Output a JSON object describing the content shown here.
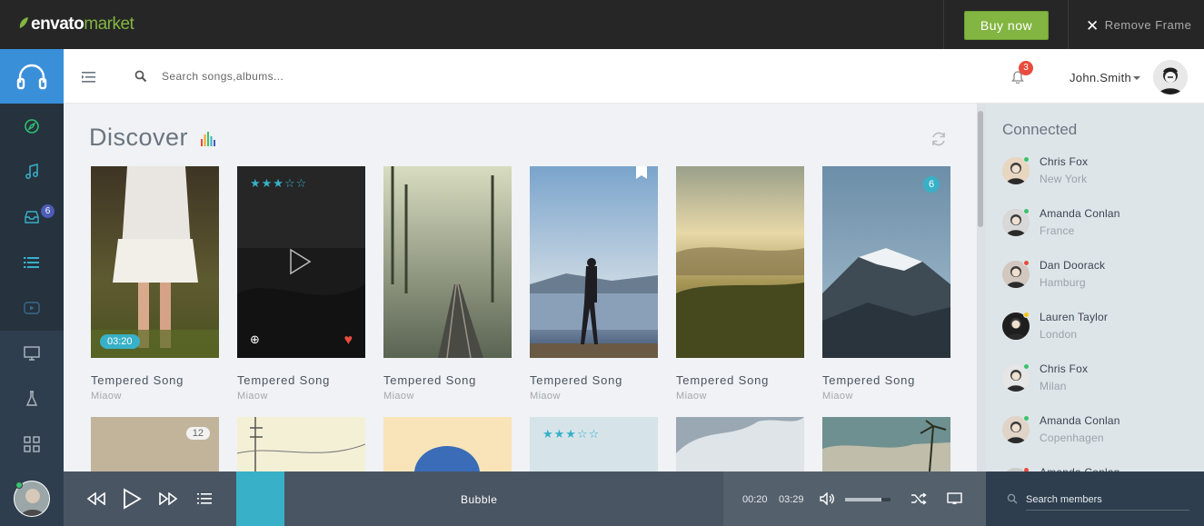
{
  "envato": {
    "logo_envato": "envato",
    "logo_market": "market",
    "buy_now": "Buy now",
    "remove_frame": "Remove Frame"
  },
  "sidebar": {
    "inbox_badge": "6",
    "items": [
      "headphones-icon",
      "compass-icon",
      "music-note-icon",
      "inbox-icon",
      "list-icon",
      "video-icon",
      "monitor-icon",
      "flask-icon",
      "grid-icon"
    ]
  },
  "header": {
    "search_placeholder": "Search songs,albums...",
    "notifications_count": "3",
    "user_name": "John.Smith"
  },
  "main": {
    "title": "Discover",
    "cards": [
      {
        "title": "Tempered Song",
        "artist": "Miaow",
        "time": "03:20"
      },
      {
        "title": "Tempered Song",
        "artist": "Miaow",
        "rating": 3
      },
      {
        "title": "Tempered Song",
        "artist": "Miaow"
      },
      {
        "title": "Tempered Song",
        "artist": "Miaow"
      },
      {
        "title": "Tempered Song",
        "artist": "Miaow"
      },
      {
        "title": "Tempered Song",
        "artist": "Miaow",
        "badge": "6"
      }
    ],
    "row2": [
      {
        "badge": "12"
      },
      {},
      {},
      {
        "rating": 3
      },
      {},
      {}
    ]
  },
  "connected": {
    "title": "Connected",
    "members": [
      {
        "name": "Chris Fox",
        "location": "New York",
        "status_color": "#3cc26c"
      },
      {
        "name": "Amanda Conlan",
        "location": "France",
        "status_color": "#3cc26c"
      },
      {
        "name": "Dan Doorack",
        "location": "Hamburg",
        "status_color": "#e84c3d"
      },
      {
        "name": "Lauren Taylor",
        "location": "London",
        "status_color": "#f5c518"
      },
      {
        "name": "Chris Fox",
        "location": "Milan",
        "status_color": "#3cc26c"
      },
      {
        "name": "Amanda Conlan",
        "location": "Copenhagen",
        "status_color": "#3cc26c"
      },
      {
        "name": "Amanda Conlan",
        "location": "",
        "status_color": "#e84c3d"
      }
    ]
  },
  "player": {
    "track_title": "Bubble",
    "current_time": "00:20",
    "total_time": "03:29",
    "volume": 0.8,
    "members_search_placeholder": "Search members"
  }
}
